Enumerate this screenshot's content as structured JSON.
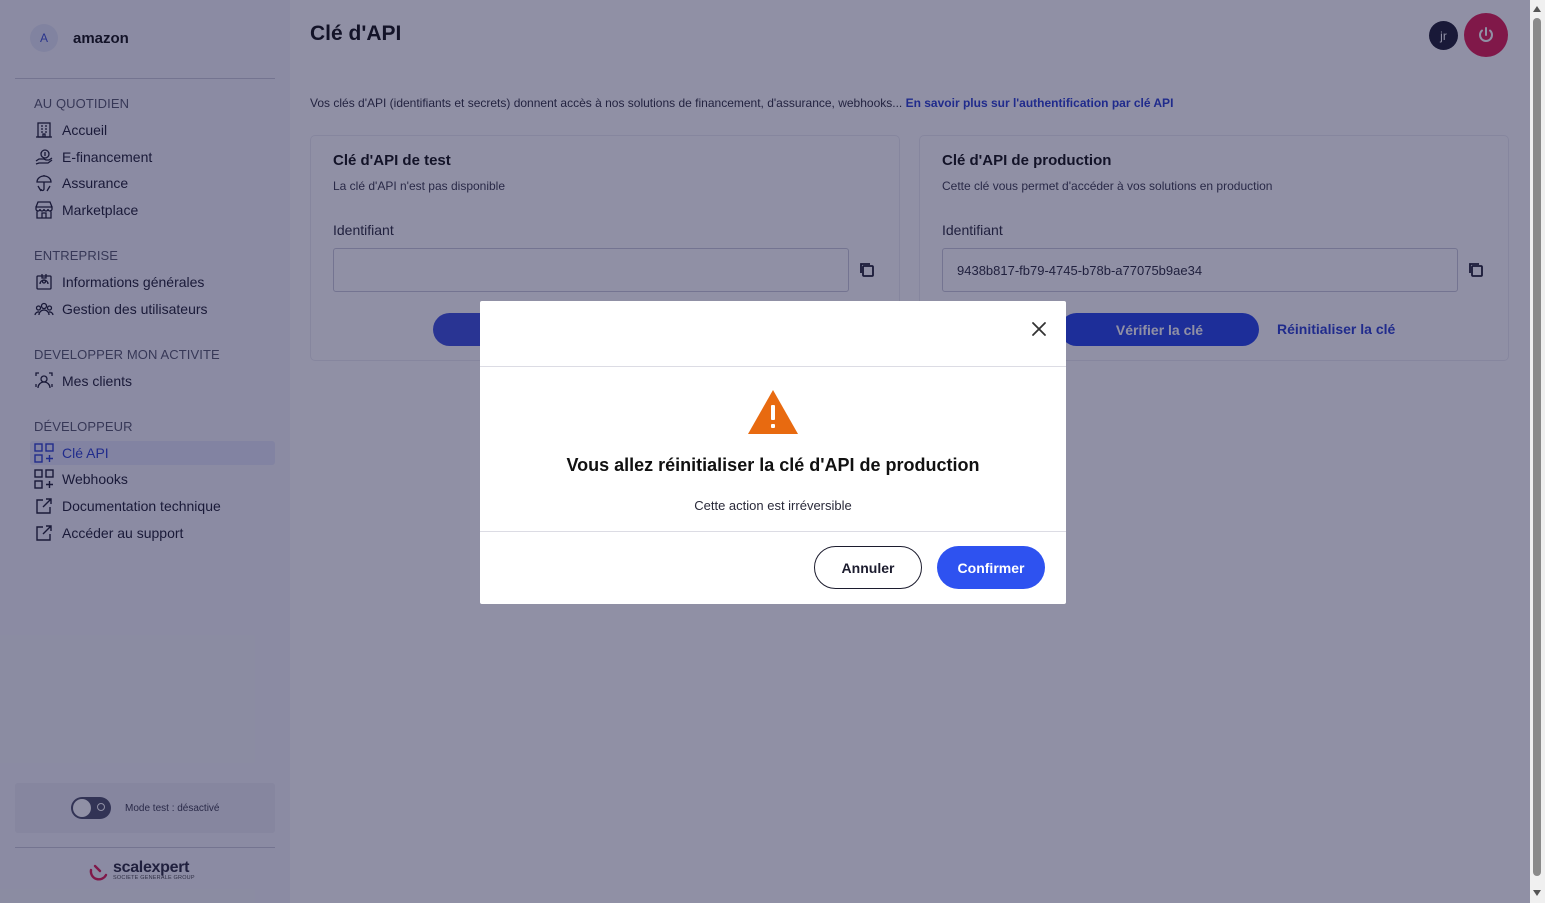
{
  "sidebar": {
    "org_initial": "A",
    "org_name": "amazon",
    "sections": [
      {
        "title": "AU QUOTIDIEN"
      },
      {
        "title": "ENTREPRISE"
      },
      {
        "title": "DEVELOPPER MON ACTIVITE"
      },
      {
        "title": "DÉVELOPPEUR"
      }
    ],
    "items": [
      {
        "label": "Accueil",
        "icon": "building-icon"
      },
      {
        "label": "E-financement",
        "icon": "money-hand-icon"
      },
      {
        "label": "Assurance",
        "icon": "umbrella-icon"
      },
      {
        "label": "Marketplace",
        "icon": "store-icon"
      },
      {
        "label": "Informations générales",
        "icon": "id-card-icon"
      },
      {
        "label": "Gestion des utilisateurs",
        "icon": "users-icon"
      },
      {
        "label": "Mes clients",
        "icon": "client-icon"
      },
      {
        "label": "Clé API",
        "icon": "api-key-icon",
        "active": true
      },
      {
        "label": "Webhooks",
        "icon": "webhooks-icon"
      },
      {
        "label": "Documentation technique",
        "icon": "external-link-icon"
      },
      {
        "label": "Accéder au support",
        "icon": "external-link-icon"
      }
    ],
    "mode_label": "Mode test : désactivé",
    "logo": {
      "name": "scalexpert",
      "tagline": "SOCIETE GENERALE GROUP"
    }
  },
  "header": {
    "title": "Clé d'API",
    "user_initials": "jr"
  },
  "intro": {
    "text": "Vos clés d'API (identifiants et secrets) donnent accès à nos solutions de financement, d'assurance, webhooks... ",
    "link": "En savoir plus sur l'authentification par clé API"
  },
  "cards": {
    "test": {
      "title": "Clé d'API de test",
      "subtitle": "La clé d'API n'est pas disponible",
      "field_label": "Identifiant",
      "field_value": ""
    },
    "production": {
      "title": "Clé d'API de production",
      "subtitle": "Cette clé vous permet d'accéder à vos solutions en production",
      "field_label": "Identifiant",
      "field_value": "9438b817-fb79-4745-b78b-a77075b9ae34",
      "verify_label": "Vérifier la clé",
      "reset_label": "Réinitialiser la clé"
    }
  },
  "modal": {
    "title": "Vous allez réinitialiser la clé d'API de production",
    "text": "Cette action est irréversible",
    "cancel_label": "Annuler",
    "confirm_label": "Confirmer"
  },
  "colors": {
    "accent": "#2e52f0",
    "danger": "#e0194f",
    "warning": "#e86a10",
    "overlay": "#161842"
  }
}
